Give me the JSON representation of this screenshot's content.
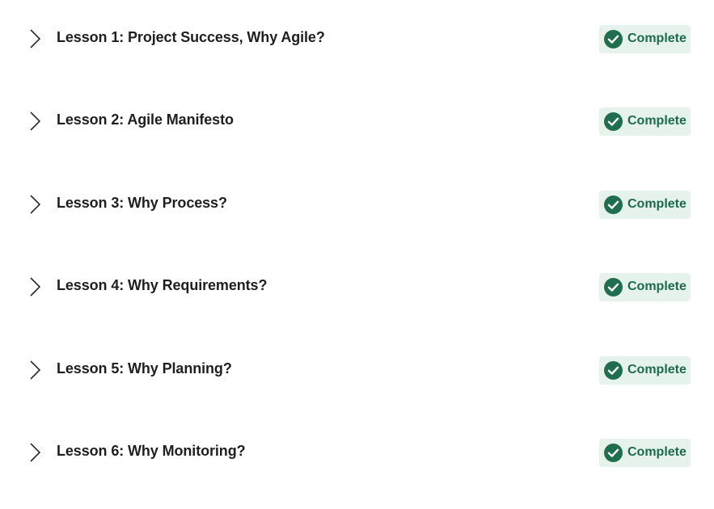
{
  "colors": {
    "title": "#1f1f1f",
    "badge_background": "#e6f2ec",
    "badge_text": "#1d6b4c",
    "check_fill": "#1f6e4d",
    "chevron": "#2b2b2b"
  },
  "lessons": [
    {
      "title": "Lesson 1: Project Success, Why Agile?",
      "status": "Complete",
      "expand_icon": "chevron-right-icon",
      "status_icon": "check-circle-icon"
    },
    {
      "title": "Lesson 2: Agile Manifesto",
      "status": "Complete",
      "expand_icon": "chevron-right-icon",
      "status_icon": "check-circle-icon"
    },
    {
      "title": "Lesson 3: Why Process?",
      "status": "Complete",
      "expand_icon": "chevron-right-icon",
      "status_icon": "check-circle-icon"
    },
    {
      "title": "Lesson 4: Why Requirements?",
      "status": "Complete",
      "expand_icon": "chevron-right-icon",
      "status_icon": "check-circle-icon"
    },
    {
      "title": "Lesson 5: Why Planning?",
      "status": "Complete",
      "expand_icon": "chevron-right-icon",
      "status_icon": "check-circle-icon"
    },
    {
      "title": "Lesson 6: Why Monitoring?",
      "status": "Complete",
      "expand_icon": "chevron-right-icon",
      "status_icon": "check-circle-icon"
    }
  ]
}
